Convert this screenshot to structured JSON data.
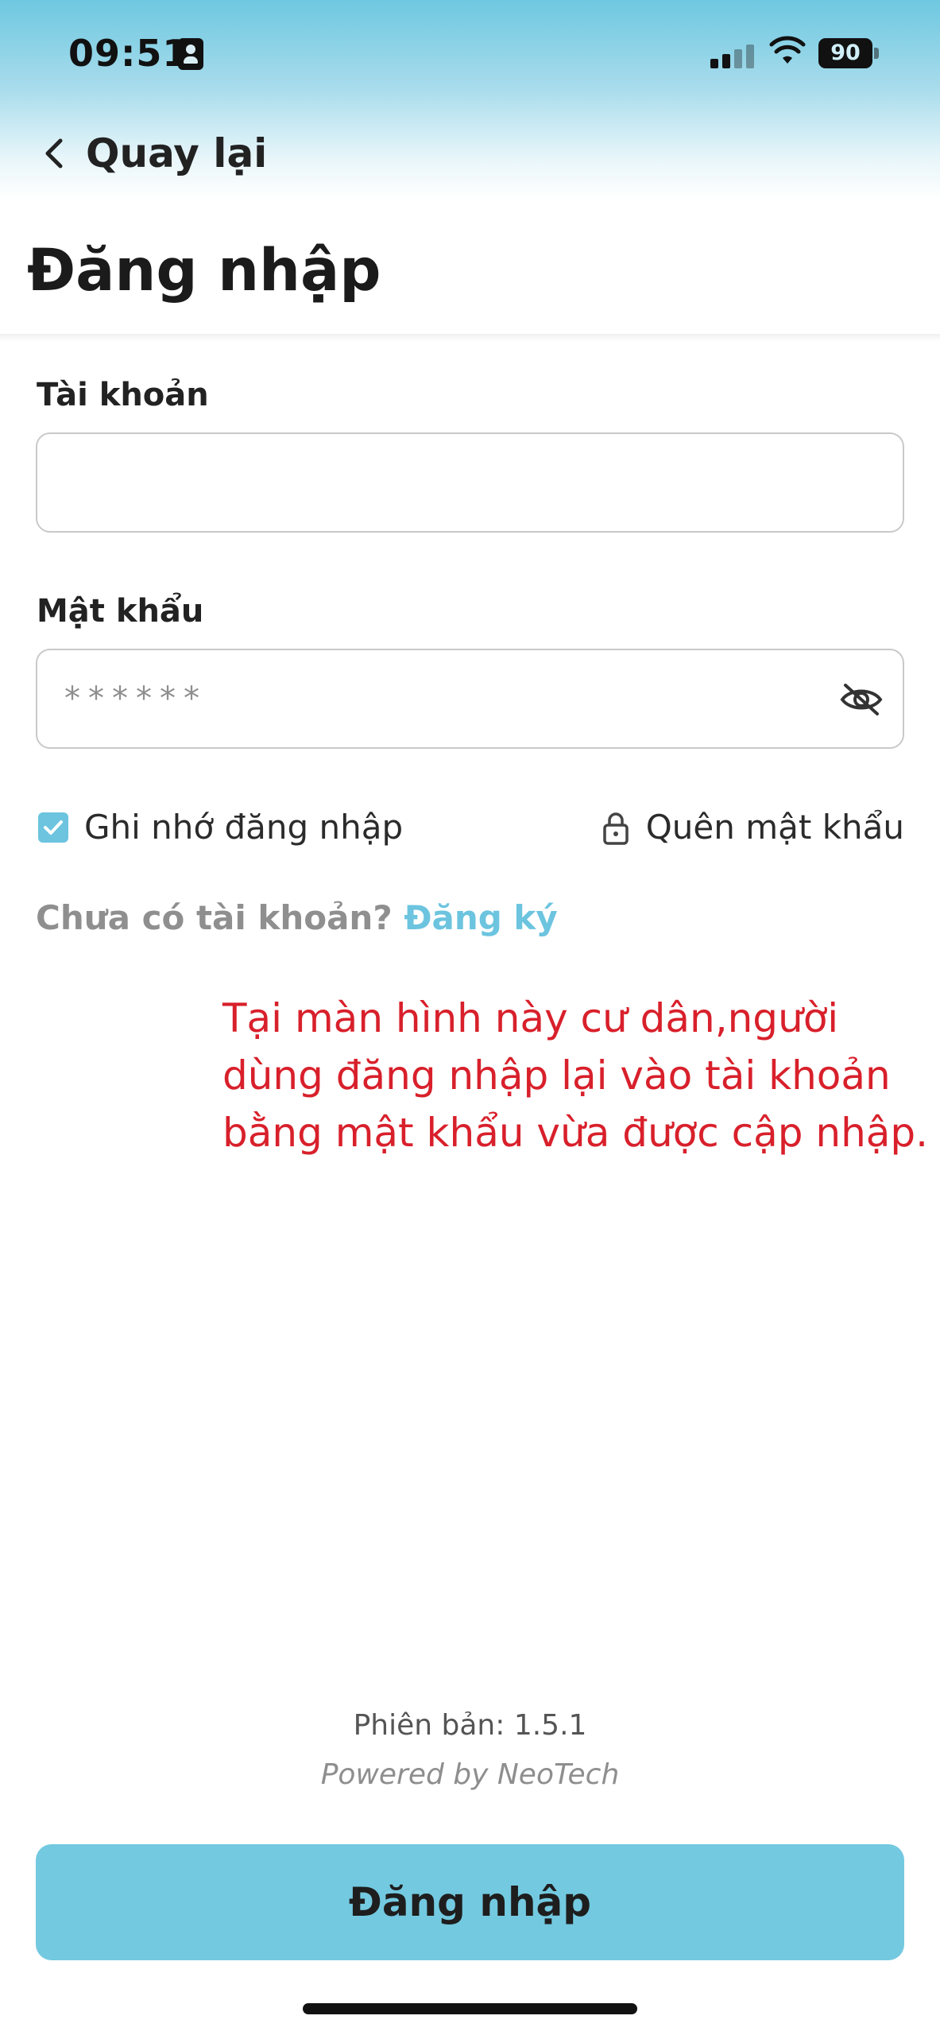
{
  "status_bar": {
    "time": "09:51",
    "battery": "90"
  },
  "nav": {
    "back_label": "Quay lại"
  },
  "page": {
    "title": "Đăng nhập"
  },
  "form": {
    "account_label": "Tài khoản",
    "account_value": "",
    "password_label": "Mật khẩu",
    "password_placeholder": "******",
    "remember_checked": true,
    "remember_label": "Ghi nhớ đăng nhập",
    "forgot_label": "Quên mật khẩu",
    "register_prompt": "Chưa có tài khoản?",
    "register_link": "Đăng ký"
  },
  "annotation": {
    "text": "Tại màn hình này cư dân,người dùng đăng nhập lại vào tài khoản bằng mật khẩu vừa được cập nhập."
  },
  "footer": {
    "version": "Phiên bản: 1.5.1",
    "powered_by": "Powered by NeoTech",
    "login_button": "Đăng nhập"
  },
  "colors": {
    "accent": "#6cc4df",
    "annotation": "#d8202b",
    "header_gradient_top": "#6ec8e0"
  },
  "icons": {
    "back": "chevron-left-icon",
    "password_toggle": "eye-off-icon",
    "forgot": "lock-icon",
    "remember": "checkbox-checked-icon"
  }
}
